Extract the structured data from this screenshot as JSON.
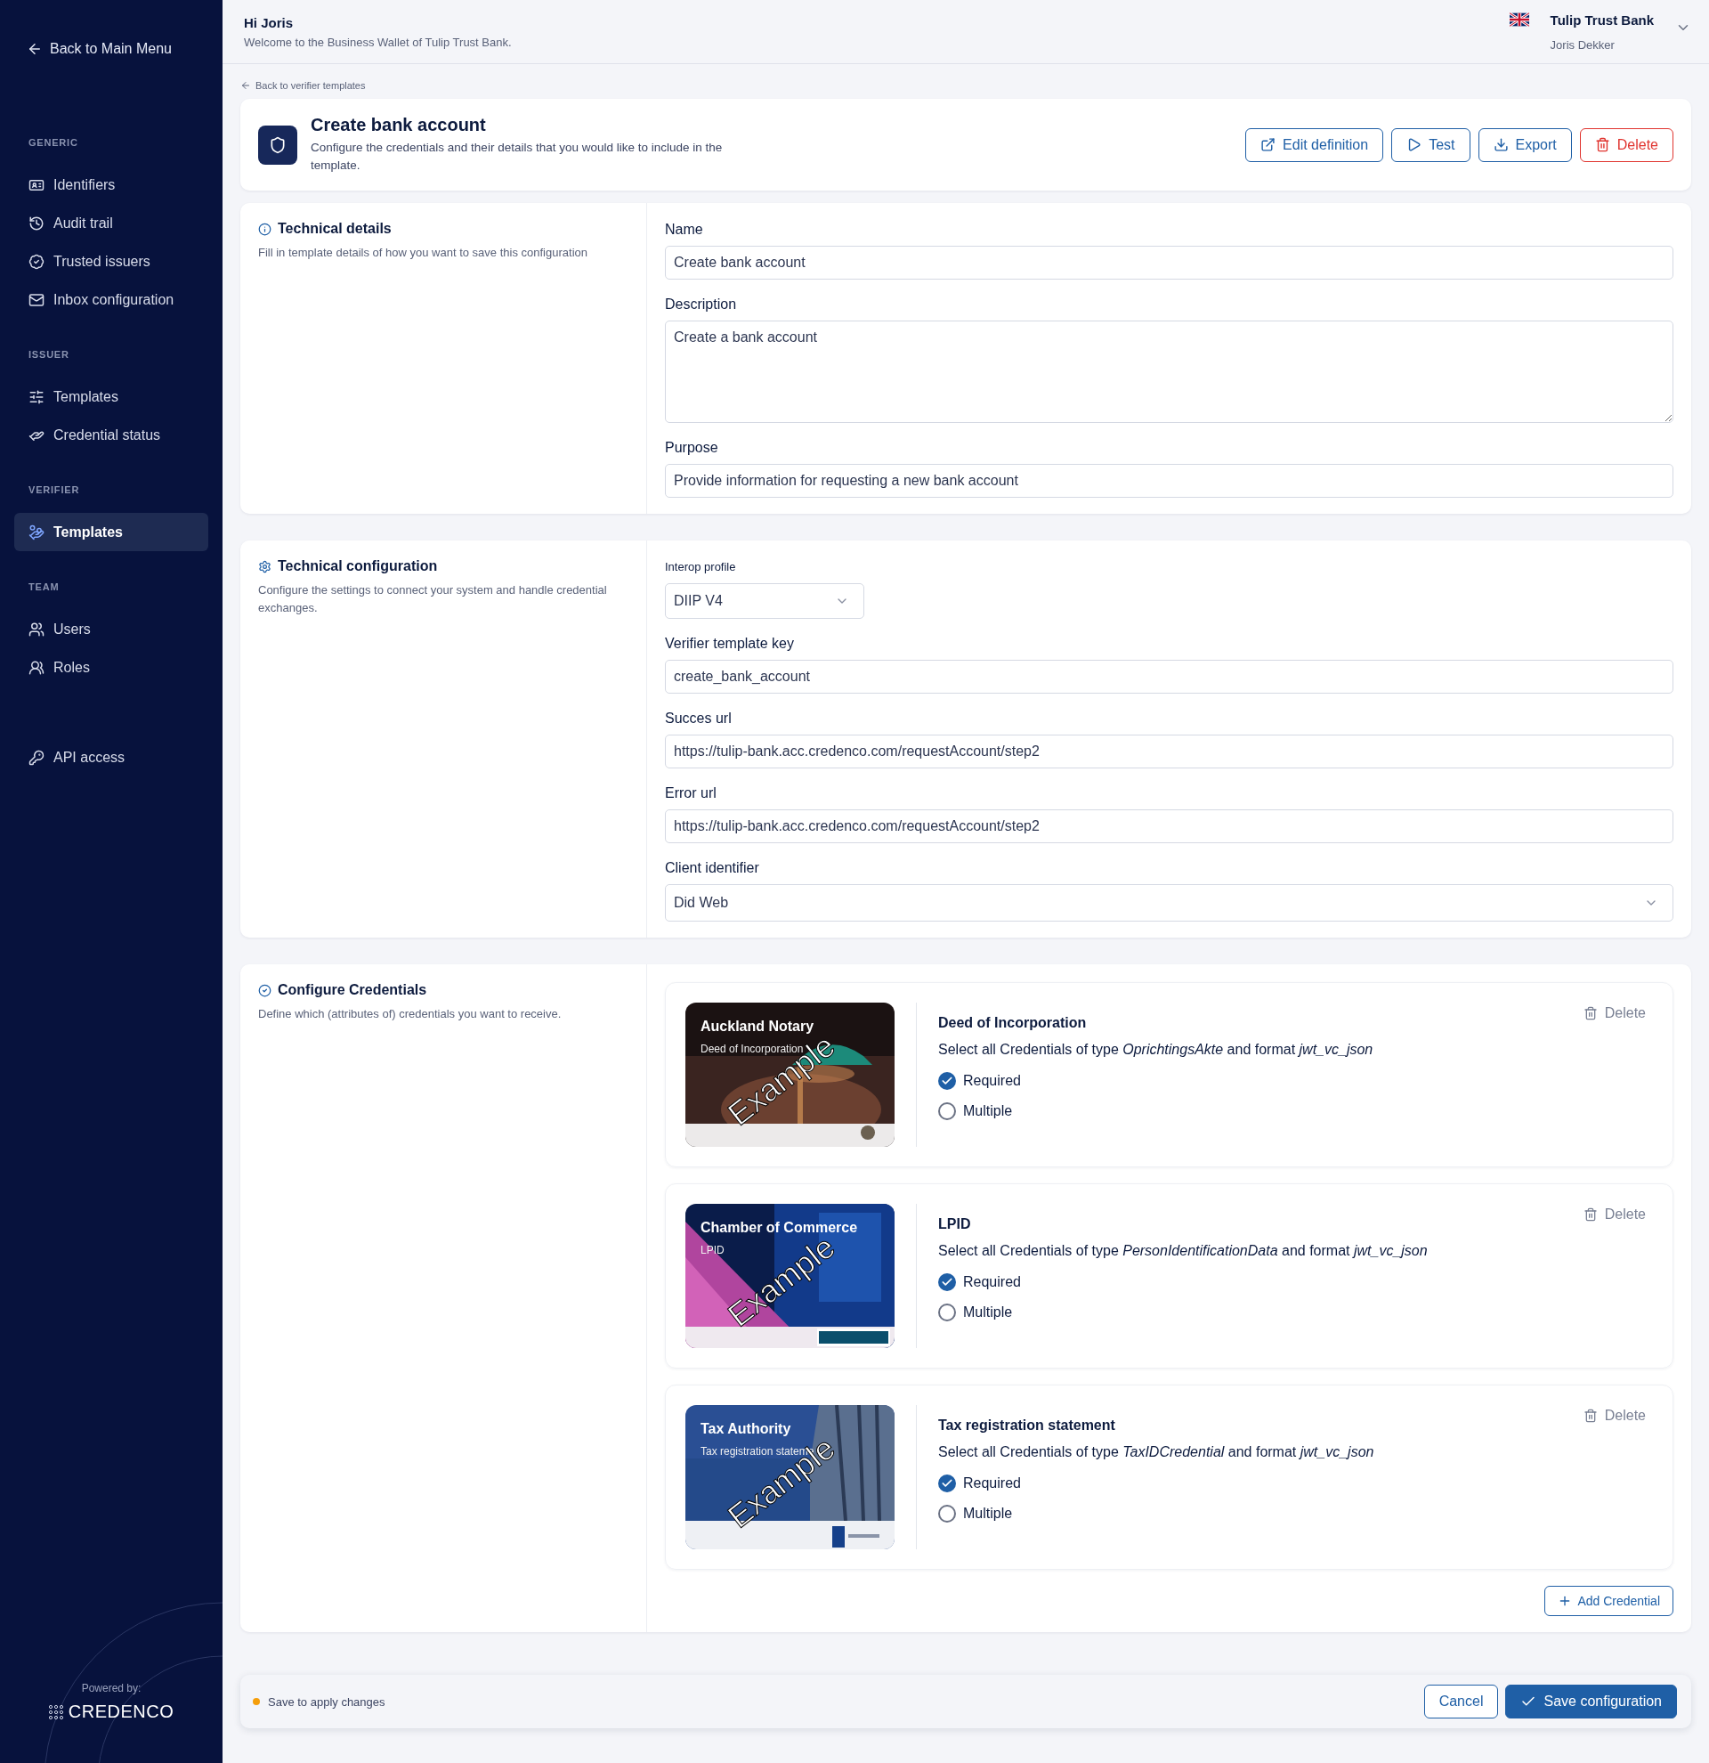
{
  "sidebar": {
    "back": "Back to Main Menu",
    "sections": [
      {
        "heading": "GENERIC",
        "items": [
          {
            "label": "Identifiers",
            "selected": false
          },
          {
            "label": "Audit trail",
            "selected": false
          },
          {
            "label": "Trusted issuers",
            "selected": false
          },
          {
            "label": "Inbox configuration",
            "selected": false
          }
        ]
      },
      {
        "heading": "ISSUER",
        "items": [
          {
            "label": "Templates",
            "selected": false
          },
          {
            "label": "Credential status",
            "selected": false
          }
        ]
      },
      {
        "heading": "VERIFIER",
        "items": [
          {
            "label": "Templates",
            "selected": true
          }
        ]
      },
      {
        "heading": "TEAM",
        "items": [
          {
            "label": "Users",
            "selected": false
          },
          {
            "label": "Roles",
            "selected": false
          }
        ]
      },
      {
        "items": [
          {
            "label": "API access",
            "selected": false
          }
        ]
      }
    ],
    "powered_by": "Powered by:",
    "brand": "CREDENCO"
  },
  "header": {
    "greeting": "Hi Joris",
    "welcome": "Welcome to the Business Wallet of Tulip Trust Bank.",
    "organization": "Tulip Trust Bank",
    "user": "Joris Dekker"
  },
  "back_link": "Back to verifier templates",
  "page": {
    "title": "Create bank account",
    "description": "Configure the credentials and their details that you would like to include in the template.",
    "actions": [
      {
        "label": "Edit definition",
        "kind": "edit"
      },
      {
        "label": "Test",
        "kind": "test"
      },
      {
        "label": "Export",
        "kind": "export"
      },
      {
        "label": "Delete",
        "kind": "delete"
      }
    ]
  },
  "sections": [
    {
      "kind": "details",
      "title": "Technical details",
      "description": "Fill in template details of how you want to save this configuration",
      "fields": [
        {
          "label": "Name",
          "kind": "input",
          "value": "Create bank account"
        },
        {
          "label": "Description",
          "kind": "textarea",
          "value": "Create a bank account"
        },
        {
          "label": "Purpose",
          "kind": "input",
          "value": "Provide information for requesting a new bank account"
        }
      ]
    },
    {
      "kind": "config",
      "title": "Technical configuration",
      "description": "Configure the settings to connect your system and handle credential exchanges.",
      "fields": [
        {
          "label": "Interop profile",
          "kind": "dropdown",
          "value": "DIIP V4"
        },
        {
          "label": "Verifier template key",
          "kind": "input",
          "value": "create_bank_account"
        },
        {
          "label": "Succes url",
          "kind": "input",
          "value": "https://tulip-bank.acc.credenco.com/requestAccount/step2"
        },
        {
          "label": "Error url",
          "kind": "input",
          "value": "https://tulip-bank.acc.credenco.com/requestAccount/step2"
        },
        {
          "label": "Client identifier",
          "kind": "select",
          "value": "Did Web"
        }
      ]
    },
    {
      "kind": "credentials",
      "title": "Configure Credentials",
      "description": "Define which (attributes of) credentials you want to receive.",
      "credentials": [
        {
          "card_title": "Auckland Notary",
          "card_subtitle": "Deed of Incorporation",
          "card_mark": "Example",
          "name": "Deed of Incorporation",
          "text": "Select all Credentials of type *OprichtingsAkte* and format *jwt_vc_json*",
          "delete": "Delete",
          "options": [
            {
              "label": "Required",
              "checked": true
            },
            {
              "label": "Multiple",
              "checked": false
            }
          ]
        },
        {
          "card_title": "Chamber of Commerce",
          "card_subtitle": "LPID",
          "card_mark": "Example",
          "name": "LPID",
          "text": "Select all Credentials of type *PersonIdentificationData* and format *jwt_vc_json*",
          "delete": "Delete",
          "options": [
            {
              "label": "Required",
              "checked": true
            },
            {
              "label": "Multiple",
              "checked": false
            }
          ]
        },
        {
          "card_title": "Tax Authority",
          "card_subtitle": "Tax registration stateme",
          "card_mark": "Example",
          "name": "Tax registration statement",
          "text": "Select all Credentials of type *TaxIDCredential* and format *jwt_vc_json*",
          "delete": "Delete",
          "options": [
            {
              "label": "Required",
              "checked": true
            },
            {
              "label": "Multiple",
              "checked": false
            }
          ]
        }
      ],
      "add": "Add Credential"
    }
  ],
  "footer": {
    "status": "Save to apply changes",
    "cancel": "Cancel",
    "save": "Save configuration"
  }
}
